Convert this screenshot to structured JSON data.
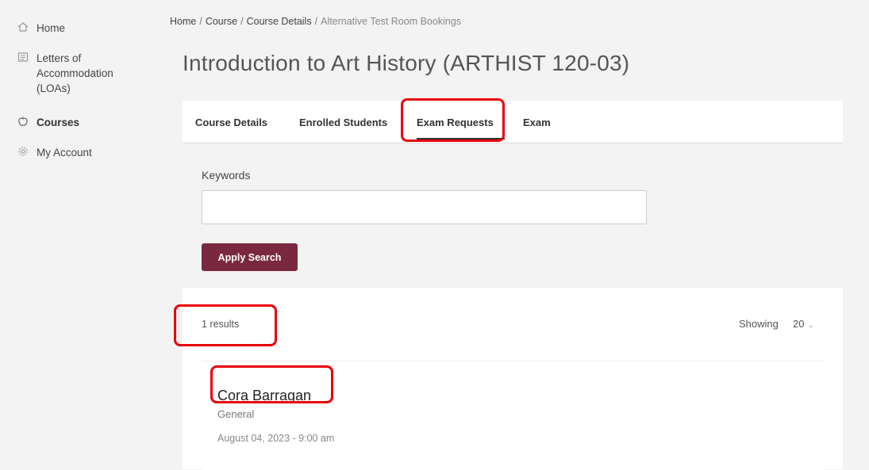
{
  "sidebar": {
    "items": [
      {
        "label": "Home",
        "icon": "home-icon"
      },
      {
        "label": "Letters of\nAccommodation\n(LOAs)",
        "icon": "document-list-icon"
      },
      {
        "label": "Courses",
        "icon": "apple-icon"
      },
      {
        "label": "My Account",
        "icon": "gear-icon"
      }
    ]
  },
  "breadcrumb": {
    "items": [
      "Home",
      "Course",
      "Course Details"
    ],
    "separator": "/",
    "current": "Alternative Test Room Bookings"
  },
  "page": {
    "title": "Introduction to Art History (ARTHIST 120-03)"
  },
  "tabs": [
    {
      "label": "Course Details"
    },
    {
      "label": "Enrolled Students"
    },
    {
      "label": "Exam Requests",
      "active": true
    },
    {
      "label": "Exam"
    }
  ],
  "search": {
    "keywords_label": "Keywords",
    "keywords_value": "",
    "apply_label": "Apply Search"
  },
  "results": {
    "count_text": "1 results",
    "showing_label": "Showing",
    "page_size": "20",
    "items": [
      {
        "name": "Cora Barragan",
        "type": "General",
        "date": "August 04, 2023 - 9:00 am"
      }
    ]
  },
  "colors": {
    "primary_button": "#7a2840",
    "highlight": "#e8000b",
    "background": "#f3f3f3"
  }
}
